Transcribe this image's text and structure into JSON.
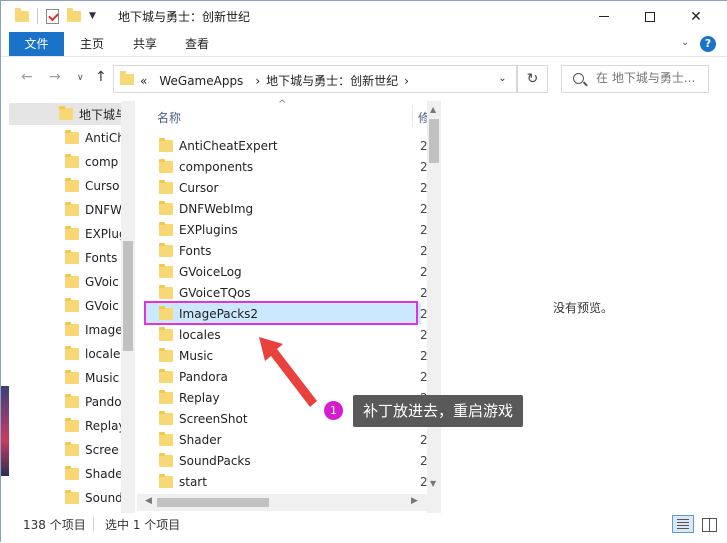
{
  "window": {
    "title": "地下城与勇士：创新世纪",
    "minimize_label": "",
    "close_glyph": "✕"
  },
  "ribbon": {
    "tabs": [
      "文件",
      "主页",
      "共享",
      "查看"
    ],
    "collapse_glyph": "⌄",
    "help_glyph": "?"
  },
  "address": {
    "overflow": "«",
    "path": [
      "WeGameApps",
      "地下城与勇士：创新世纪"
    ],
    "separator": "›",
    "dropdown_glyph": "⌄",
    "refresh_glyph": "↻"
  },
  "search": {
    "placeholder": "在 地下城与勇士..."
  },
  "nav_pane": {
    "root": "地下城与",
    "items": [
      "AntiCh",
      "comp",
      "Curso",
      "DNFW",
      "EXPlug",
      "Fonts",
      "GVoic",
      "GVoic",
      "Image",
      "locale",
      "Music",
      "Pando",
      "Replay",
      "Scree",
      "Shade",
      "Sound"
    ]
  },
  "file_list": {
    "column_name": "名称",
    "column_date": "修",
    "sort_glyph": "^",
    "date_prefix": "2",
    "items": [
      "AntiCheatExpert",
      "components",
      "Cursor",
      "DNFWebImg",
      "EXPlugins",
      "Fonts",
      "GVoiceLog",
      "GVoiceTQos",
      "ImagePacks2",
      "locales",
      "Music",
      "Pandora",
      "Replay",
      "ScreenShot",
      "Shader",
      "SoundPacks",
      "start"
    ],
    "selected_index": 8
  },
  "preview": {
    "text": "没有预览。"
  },
  "annotation": {
    "badge": "1",
    "text": "补丁放进去，重启游戏",
    "highlight_color": "#e133d9",
    "arrow_color": "#e8413e"
  },
  "status": {
    "count": "138 个项目",
    "selected": "选中 1 个项目"
  },
  "colors": {
    "accent": "#1a73c8",
    "selection": "#cce8ff",
    "folder": "#f8d775"
  }
}
